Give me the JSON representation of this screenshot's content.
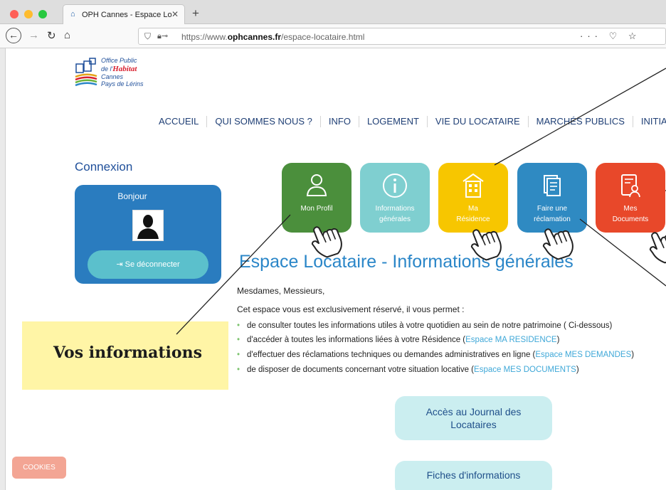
{
  "browser": {
    "tab_title": "OPH Cannes - Espace Locataire",
    "tab_close": "✕",
    "new_tab": "+",
    "url_prefix": "https://www.",
    "url_domain": "ophcannes.fr",
    "url_path": "/espace-locataire.html",
    "url_actions": "··· ♡ ☆"
  },
  "logo": {
    "line1": "Office Public",
    "line2_de": "de l'",
    "line2_brand": "Habitat",
    "line3": "Cannes",
    "line4": "Pays de Lérins"
  },
  "menu": {
    "items": [
      "ACCUEIL",
      "QUI SOMMES NOUS ?",
      "INFO",
      "LOGEMENT",
      "VIE DU LOCATAIRE",
      "MARCHÉS PUBLICS",
      "INITIATIVES"
    ]
  },
  "connexion": {
    "title": "Connexion",
    "greeting": "Bonjour",
    "logout_label": "Se déconnecter"
  },
  "tiles": [
    {
      "line1": "Mon Profil",
      "line2": "",
      "color": "#4b8f3c"
    },
    {
      "line1": "Informations",
      "line2": "générales",
      "color": "#7fcfd0"
    },
    {
      "line1": "Ma",
      "line2": "Résidence",
      "color": "#f7c600"
    },
    {
      "line1": "Faire une",
      "line2": "réclamation",
      "color": "#2f8ac2"
    },
    {
      "line1": "Mes",
      "line2": "Documents",
      "color": "#e8482a"
    }
  ],
  "main": {
    "title": "Espace Locataire - Informations générales",
    "salutation": "Mesdames, Messieurs,",
    "intro": "Cet espace vous est exclusivement réservé, il vous permet :",
    "bullets": [
      {
        "text": "de consulter toutes les informations utiles à votre quotidien au sein de notre patrimoine ( Ci-dessous)",
        "link": "",
        "tail": ""
      },
      {
        "text": "d'accéder à toutes les informations liées à votre Résidence (",
        "link": "Espace MA RESIDENCE",
        "tail": ")"
      },
      {
        "text": "d'effectuer des réclamations techniques ou demandes administratives en ligne (",
        "link": "Espace MES DEMANDES",
        "tail": ")"
      },
      {
        "text": "de disposer de documents concernant votre situation locative  (",
        "link": "Espace MES DOCUMENTS",
        "tail": ")"
      }
    ],
    "journal_line1": "Accès au Journal des",
    "journal_line2": "Locataires",
    "fiches": "Fiches d'informations"
  },
  "annotation": {
    "callout": "Vos informations"
  },
  "cookies": "COOKIES"
}
